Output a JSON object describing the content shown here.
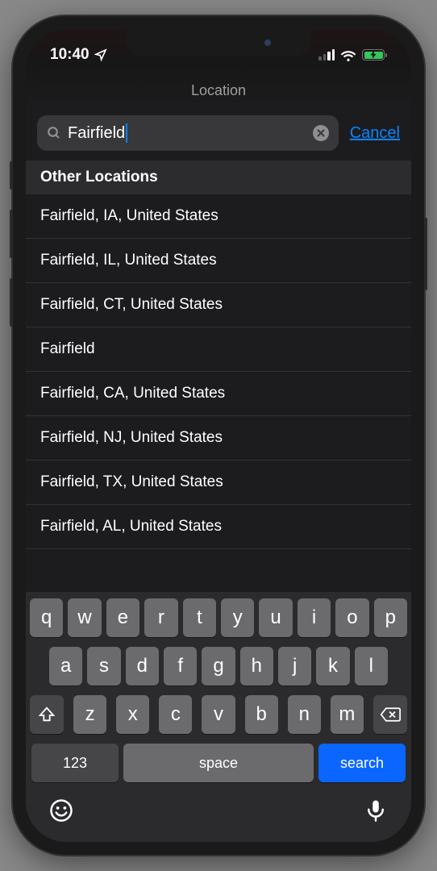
{
  "statusBar": {
    "time": "10:40"
  },
  "header": {
    "title": "Location"
  },
  "search": {
    "value": "Fairfield",
    "cancelLabel": "Cancel"
  },
  "section": {
    "title": "Other Locations"
  },
  "results": [
    "Fairfield, IA, United States",
    "Fairfield, IL, United States",
    "Fairfield, CT, United States",
    "Fairfield",
    "Fairfield, CA, United States",
    "Fairfield, NJ, United States",
    "Fairfield, TX, United States",
    "Fairfield, AL, United States"
  ],
  "keyboard": {
    "row1": [
      "q",
      "w",
      "e",
      "r",
      "t",
      "y",
      "u",
      "i",
      "o",
      "p"
    ],
    "row2": [
      "a",
      "s",
      "d",
      "f",
      "g",
      "h",
      "j",
      "k",
      "l"
    ],
    "row3": [
      "z",
      "x",
      "c",
      "v",
      "b",
      "n",
      "m"
    ],
    "numKey": "123",
    "spaceKey": "space",
    "searchKey": "search"
  }
}
